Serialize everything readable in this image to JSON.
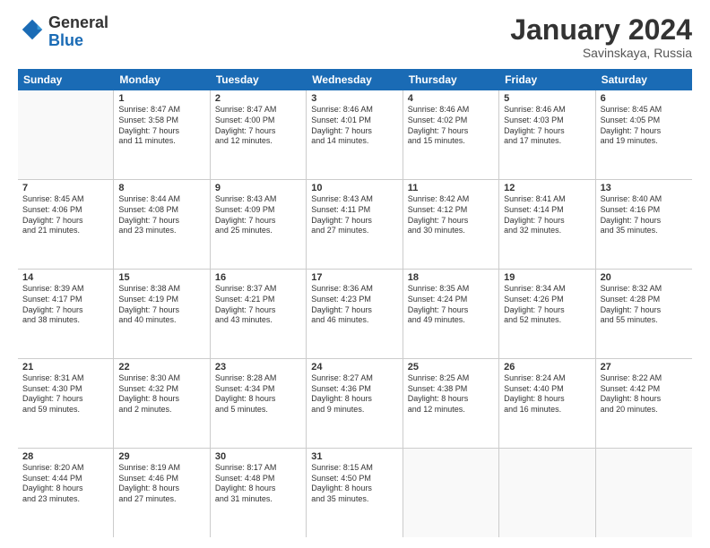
{
  "logo": {
    "line1": "General",
    "line2": "Blue"
  },
  "title": "January 2024",
  "location": "Savinskaya, Russia",
  "days_header": [
    "Sunday",
    "Monday",
    "Tuesday",
    "Wednesday",
    "Thursday",
    "Friday",
    "Saturday"
  ],
  "weeks": [
    [
      {
        "day": "",
        "lines": []
      },
      {
        "day": "1",
        "lines": [
          "Sunrise: 8:47 AM",
          "Sunset: 3:58 PM",
          "Daylight: 7 hours",
          "and 11 minutes."
        ]
      },
      {
        "day": "2",
        "lines": [
          "Sunrise: 8:47 AM",
          "Sunset: 4:00 PM",
          "Daylight: 7 hours",
          "and 12 minutes."
        ]
      },
      {
        "day": "3",
        "lines": [
          "Sunrise: 8:46 AM",
          "Sunset: 4:01 PM",
          "Daylight: 7 hours",
          "and 14 minutes."
        ]
      },
      {
        "day": "4",
        "lines": [
          "Sunrise: 8:46 AM",
          "Sunset: 4:02 PM",
          "Daylight: 7 hours",
          "and 15 minutes."
        ]
      },
      {
        "day": "5",
        "lines": [
          "Sunrise: 8:46 AM",
          "Sunset: 4:03 PM",
          "Daylight: 7 hours",
          "and 17 minutes."
        ]
      },
      {
        "day": "6",
        "lines": [
          "Sunrise: 8:45 AM",
          "Sunset: 4:05 PM",
          "Daylight: 7 hours",
          "and 19 minutes."
        ]
      }
    ],
    [
      {
        "day": "7",
        "lines": [
          "Sunrise: 8:45 AM",
          "Sunset: 4:06 PM",
          "Daylight: 7 hours",
          "and 21 minutes."
        ]
      },
      {
        "day": "8",
        "lines": [
          "Sunrise: 8:44 AM",
          "Sunset: 4:08 PM",
          "Daylight: 7 hours",
          "and 23 minutes."
        ]
      },
      {
        "day": "9",
        "lines": [
          "Sunrise: 8:43 AM",
          "Sunset: 4:09 PM",
          "Daylight: 7 hours",
          "and 25 minutes."
        ]
      },
      {
        "day": "10",
        "lines": [
          "Sunrise: 8:43 AM",
          "Sunset: 4:11 PM",
          "Daylight: 7 hours",
          "and 27 minutes."
        ]
      },
      {
        "day": "11",
        "lines": [
          "Sunrise: 8:42 AM",
          "Sunset: 4:12 PM",
          "Daylight: 7 hours",
          "and 30 minutes."
        ]
      },
      {
        "day": "12",
        "lines": [
          "Sunrise: 8:41 AM",
          "Sunset: 4:14 PM",
          "Daylight: 7 hours",
          "and 32 minutes."
        ]
      },
      {
        "day": "13",
        "lines": [
          "Sunrise: 8:40 AM",
          "Sunset: 4:16 PM",
          "Daylight: 7 hours",
          "and 35 minutes."
        ]
      }
    ],
    [
      {
        "day": "14",
        "lines": [
          "Sunrise: 8:39 AM",
          "Sunset: 4:17 PM",
          "Daylight: 7 hours",
          "and 38 minutes."
        ]
      },
      {
        "day": "15",
        "lines": [
          "Sunrise: 8:38 AM",
          "Sunset: 4:19 PM",
          "Daylight: 7 hours",
          "and 40 minutes."
        ]
      },
      {
        "day": "16",
        "lines": [
          "Sunrise: 8:37 AM",
          "Sunset: 4:21 PM",
          "Daylight: 7 hours",
          "and 43 minutes."
        ]
      },
      {
        "day": "17",
        "lines": [
          "Sunrise: 8:36 AM",
          "Sunset: 4:23 PM",
          "Daylight: 7 hours",
          "and 46 minutes."
        ]
      },
      {
        "day": "18",
        "lines": [
          "Sunrise: 8:35 AM",
          "Sunset: 4:24 PM",
          "Daylight: 7 hours",
          "and 49 minutes."
        ]
      },
      {
        "day": "19",
        "lines": [
          "Sunrise: 8:34 AM",
          "Sunset: 4:26 PM",
          "Daylight: 7 hours",
          "and 52 minutes."
        ]
      },
      {
        "day": "20",
        "lines": [
          "Sunrise: 8:32 AM",
          "Sunset: 4:28 PM",
          "Daylight: 7 hours",
          "and 55 minutes."
        ]
      }
    ],
    [
      {
        "day": "21",
        "lines": [
          "Sunrise: 8:31 AM",
          "Sunset: 4:30 PM",
          "Daylight: 7 hours",
          "and 59 minutes."
        ]
      },
      {
        "day": "22",
        "lines": [
          "Sunrise: 8:30 AM",
          "Sunset: 4:32 PM",
          "Daylight: 8 hours",
          "and 2 minutes."
        ]
      },
      {
        "day": "23",
        "lines": [
          "Sunrise: 8:28 AM",
          "Sunset: 4:34 PM",
          "Daylight: 8 hours",
          "and 5 minutes."
        ]
      },
      {
        "day": "24",
        "lines": [
          "Sunrise: 8:27 AM",
          "Sunset: 4:36 PM",
          "Daylight: 8 hours",
          "and 9 minutes."
        ]
      },
      {
        "day": "25",
        "lines": [
          "Sunrise: 8:25 AM",
          "Sunset: 4:38 PM",
          "Daylight: 8 hours",
          "and 12 minutes."
        ]
      },
      {
        "day": "26",
        "lines": [
          "Sunrise: 8:24 AM",
          "Sunset: 4:40 PM",
          "Daylight: 8 hours",
          "and 16 minutes."
        ]
      },
      {
        "day": "27",
        "lines": [
          "Sunrise: 8:22 AM",
          "Sunset: 4:42 PM",
          "Daylight: 8 hours",
          "and 20 minutes."
        ]
      }
    ],
    [
      {
        "day": "28",
        "lines": [
          "Sunrise: 8:20 AM",
          "Sunset: 4:44 PM",
          "Daylight: 8 hours",
          "and 23 minutes."
        ]
      },
      {
        "day": "29",
        "lines": [
          "Sunrise: 8:19 AM",
          "Sunset: 4:46 PM",
          "Daylight: 8 hours",
          "and 27 minutes."
        ]
      },
      {
        "day": "30",
        "lines": [
          "Sunrise: 8:17 AM",
          "Sunset: 4:48 PM",
          "Daylight: 8 hours",
          "and 31 minutes."
        ]
      },
      {
        "day": "31",
        "lines": [
          "Sunrise: 8:15 AM",
          "Sunset: 4:50 PM",
          "Daylight: 8 hours",
          "and 35 minutes."
        ]
      },
      {
        "day": "",
        "lines": []
      },
      {
        "day": "",
        "lines": []
      },
      {
        "day": "",
        "lines": []
      }
    ]
  ]
}
